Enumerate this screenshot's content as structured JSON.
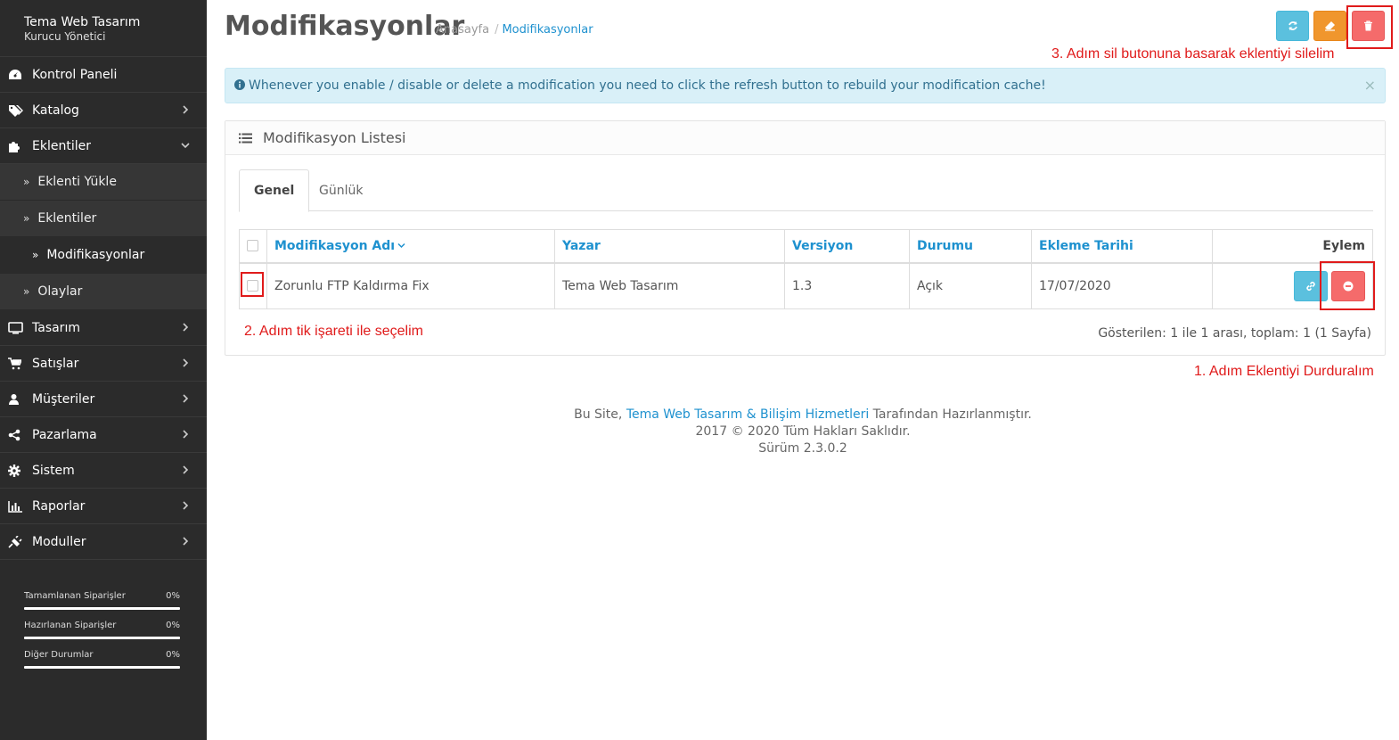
{
  "sidebar": {
    "profile": {
      "name": "Tema Web Tasarım",
      "role": "Kurucu Yönetici"
    },
    "items": [
      {
        "label": "Kontrol Paneli",
        "icon": "dashboard-icon"
      },
      {
        "label": "Katalog",
        "icon": "tags-icon"
      },
      {
        "label": "Eklentiler",
        "icon": "puzzle-icon"
      },
      {
        "label": "Tasarım",
        "icon": "monitor-icon"
      },
      {
        "label": "Satışlar",
        "icon": "cart-icon"
      },
      {
        "label": "Müşteriler",
        "icon": "user-icon"
      },
      {
        "label": "Pazarlama",
        "icon": "share-icon"
      },
      {
        "label": "Sistem",
        "icon": "gear-icon"
      },
      {
        "label": "Raporlar",
        "icon": "bar-chart-icon"
      },
      {
        "label": "Moduller",
        "icon": "plug-icon"
      }
    ],
    "sub_items": [
      {
        "label": "Eklenti Yükle"
      },
      {
        "label": "Eklentiler"
      },
      {
        "label": "Modifikasyonlar"
      },
      {
        "label": "Olaylar"
      }
    ],
    "stats": [
      {
        "label": "Tamamlanan Siparişler",
        "value": "0%"
      },
      {
        "label": "Hazırlanan Siparişler",
        "value": "0%"
      },
      {
        "label": "Diğer Durumlar",
        "value": "0%"
      }
    ]
  },
  "header": {
    "title": "Modifikasyonlar",
    "breadcrumb": [
      "Anasayfa",
      "Modifikasyonlar"
    ],
    "breadcrumb_sep": "/"
  },
  "alert": {
    "text": "Whenever you enable / disable or delete a modification you need to click the refresh button to rebuild your modification cache!",
    "close": "×"
  },
  "panel": {
    "title": "Modifikasyon Listesi",
    "tabs": [
      "Genel",
      "Günlük"
    ],
    "columns": [
      "Modifikasyon Adı",
      "Yazar",
      "Versiyon",
      "Durumu",
      "Ekleme Tarihi",
      "Eylem"
    ],
    "rows": [
      {
        "name": "Zorunlu FTP Kaldırma Fix",
        "author": "Tema Web Tasarım",
        "version": "1.3",
        "status": "Açık",
        "date": "17/07/2020"
      }
    ],
    "pagination": "Gösterilen: 1 ile 1 arası, toplam: 1 (1 Sayfa)"
  },
  "annotations": {
    "step1": "1. Adım Eklentiyi Durduralım",
    "step2": "2. Adım tik işareti ile seçelim",
    "step3": "3. Adım sil butonuna basarak eklentiyi silelim"
  },
  "footer": {
    "prefix": "Bu Site, ",
    "link": "Tema Web Tasarım & Bilişim Hizmetleri",
    "suffix": " Tarafından Hazırlanmıştır.",
    "copyright": "2017 © 2020 Tüm Hakları Saklıdır.",
    "version": "Sürüm 2.3.0.2"
  },
  "colors": {
    "sidebar_bg": "#2b2b2b",
    "link_blue": "#1e91cf",
    "btn_info": "#5bc0de",
    "btn_warning": "#f0962d",
    "btn_danger": "#f56b6b",
    "annotation_red": "#e01b1b"
  }
}
